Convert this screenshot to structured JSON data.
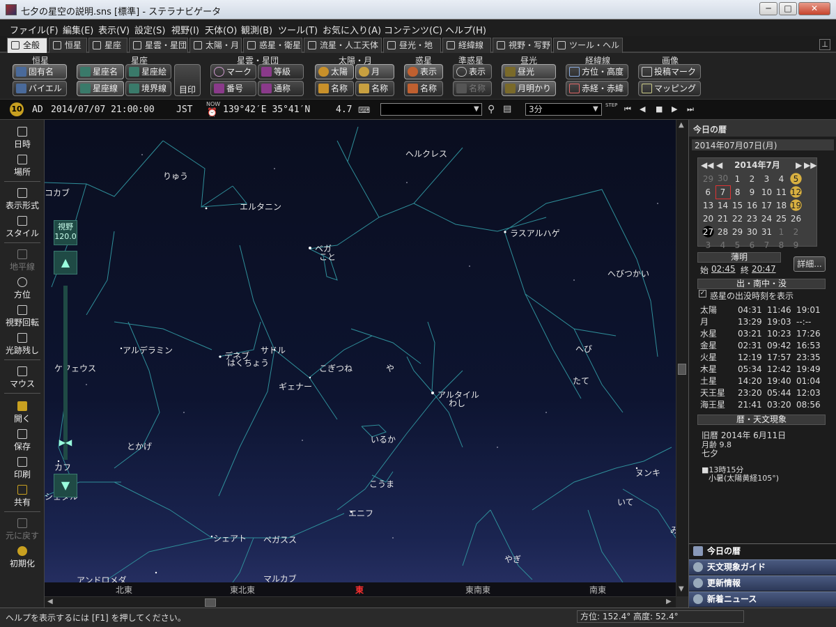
{
  "window": {
    "title": "七夕の星空の説明.sns [標準] - ステラナビゲータ",
    "min": "─",
    "max": "□",
    "close": "✕"
  },
  "menu": [
    "ファイル(F)",
    "編集(E)",
    "表示(V)",
    "設定(S)",
    "視野(I)",
    "天体(O)",
    "観測(B)",
    "ツール(T)",
    "お気に入り(A)",
    "コンテンツ(C)",
    "ヘルプ(H)"
  ],
  "tabs": [
    "全般",
    "恒星",
    "星座",
    "星雲・星団",
    "太陽・月",
    "惑星・衛星",
    "流星・人工天体",
    "昼光・地形",
    "経緯線",
    "視野・写野",
    "ツール・ヘルプ"
  ],
  "ribbon": {
    "groups": [
      "恒星",
      "星座",
      "星雲・星団",
      "太陽・月",
      "惑星",
      "準惑星",
      "昼光",
      "経緯線",
      "画像"
    ],
    "buttons": {
      "koyumei": "固有名",
      "bayer": "バイエル",
      "seizamei": "星座名",
      "seizae": "星座絵",
      "seizasen": "星座線",
      "kyokaisen": "境界線",
      "mejirushi": "目印",
      "mark": "マーク",
      "toukyuu": "等級",
      "bangou": "番号",
      "tsuushou": "通称",
      "taiyou": "太陽",
      "tsuki": "月",
      "taiyou_name": "名称",
      "tsuki_name": "名称",
      "wakusei_hyouji": "表示",
      "wakusei_name": "名称",
      "jun_hyouji": "表示",
      "jun_name": "名称",
      "chuukou": "昼光",
      "getsumeikari": "月明かり",
      "houi": "方位・高度",
      "sekikei": "赤経・赤緯",
      "touei": "投稿マーク",
      "mapping": "マッピング"
    }
  },
  "infobar": {
    "era": "AD",
    "datetime": "2014/07/07 21:00:00",
    "tz": "JST",
    "now_label": "NOW",
    "location": "139°42′E 35°41′N",
    "magnitude": "4.7",
    "search_value": "",
    "step": "3分",
    "step_label": "STEP"
  },
  "leftbar": [
    "日時",
    "場所",
    "表示形式",
    "スタイル",
    "地平線",
    "方位",
    "視野回転",
    "光跡残し",
    "マウス",
    "開く",
    "保存",
    "印刷",
    "共有",
    "元に戻す",
    "初期化"
  ],
  "fov": {
    "label": "視野",
    "value": "120.0"
  },
  "sky_labels": {
    "hercules": "ヘルクレス",
    "ryuu": "りゅう",
    "kokabu": "コカブ",
    "errai": "エルタニン",
    "vega": "ベガ",
    "koto": "こと",
    "rasalhague": "ラスアルハゲ",
    "hebitsukai": "へびつかい",
    "alderamin": "アルデラミン",
    "cepheus": "ケフェウス",
    "deneb": "デネブ",
    "hakuchou": "はくちょう",
    "sadr": "サドル",
    "kogitsune": "こぎつね",
    "ya": "や",
    "gienah": "ギェナー",
    "altair": "アルタイル",
    "washi": "わし",
    "hebi": "へび",
    "tate": "たて",
    "tokage": "とかげ",
    "iruka": "いるか",
    "kaf": "カフ",
    "kouma": "こうま",
    "schedar": "シェダル",
    "enif": "エニフ",
    "nunki": "ヌンキ",
    "ite": "いて",
    "scheat": "シェアト",
    "pegasus": "ペガスス",
    "yagi": "やぎ",
    "andromeda": "アンドロメダ",
    "markab": "マルカブ",
    "mi": "み"
  },
  "horizon": {
    "n": "北東",
    "nne": "東北東",
    "e": "東",
    "ese": "東南東",
    "se": "南東"
  },
  "right_panel": {
    "title": "今日の暦",
    "date": "2014年07月07日(月)",
    "cal_month": "2014年7月",
    "cal_rows": [
      [
        "29",
        "30",
        "1",
        "2",
        "3",
        "4",
        "5"
      ],
      [
        "6",
        "7",
        "8",
        "9",
        "10",
        "11",
        "12"
      ],
      [
        "13",
        "14",
        "15",
        "16",
        "17",
        "18",
        "19"
      ],
      [
        "20",
        "21",
        "22",
        "23",
        "24",
        "25",
        "26"
      ],
      [
        "27",
        "28",
        "29",
        "30",
        "31",
        "1",
        "2"
      ],
      [
        "3",
        "4",
        "5",
        "6",
        "7",
        "8",
        "9"
      ]
    ],
    "hakumei_label": "薄明",
    "hakumei_start_label": "始",
    "hakumei_start": "02:45",
    "hakumei_end_label": "終",
    "hakumei_end": "20:47",
    "detail_button": "詳細...",
    "rise_header": "出・南中・没",
    "rise_checkbox": "惑星の出没時刻を表示",
    "rise_table": [
      [
        "太陽",
        "04:31",
        "11:46",
        "19:01"
      ],
      [
        "月",
        "13:29",
        "19:03",
        "--:--"
      ],
      [
        "水星",
        "03:21",
        "10:23",
        "17:26"
      ],
      [
        "金星",
        "02:31",
        "09:42",
        "16:53"
      ],
      [
        "火星",
        "12:19",
        "17:57",
        "23:35"
      ],
      [
        "木星",
        "05:34",
        "12:42",
        "19:49"
      ],
      [
        "土星",
        "14:20",
        "19:40",
        "01:04"
      ],
      [
        "天王星",
        "23:20",
        "05:44",
        "12:03"
      ],
      [
        "海王星",
        "21:41",
        "03:20",
        "08:56"
      ]
    ],
    "koyomi_header": "暦・天文現象",
    "kyureki": "旧暦 2014年 6月11日",
    "getsurei": "月齢 9.8",
    "tanabata": "七夕",
    "event_time": "■13時15分",
    "event_desc": "小暑(太陽黄経105°)",
    "nav": [
      "今日の暦",
      "天文現象ガイド",
      "更新情報",
      "新着ニュース"
    ]
  },
  "status": {
    "help": "ヘルプを表示するには [F1] を押してください。",
    "azimuth": "方位: 152.4°  高度: 52.4°"
  }
}
